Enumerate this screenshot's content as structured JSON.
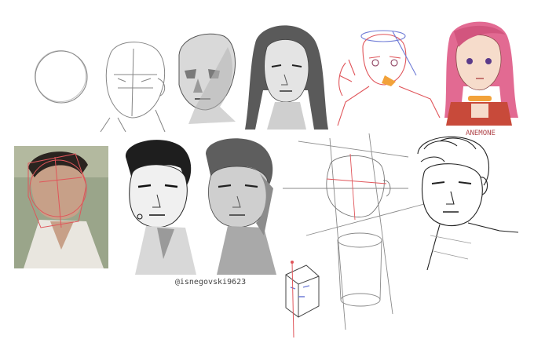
{
  "sheet": {
    "signature": "@isnegovski9623",
    "character_name": "ANEMONE"
  },
  "colors": {
    "pencil": "#7a7a7a",
    "ink": "#1e1e1e",
    "construction_red": "#e0555a",
    "construction_blue": "#6f7cd6",
    "hair_pink": "#e26a92",
    "skin": "#f6dccb",
    "collar_orange": "#f2a23a",
    "outfit_red": "#c84a3a",
    "photo_bg": "#9aa58a"
  }
}
